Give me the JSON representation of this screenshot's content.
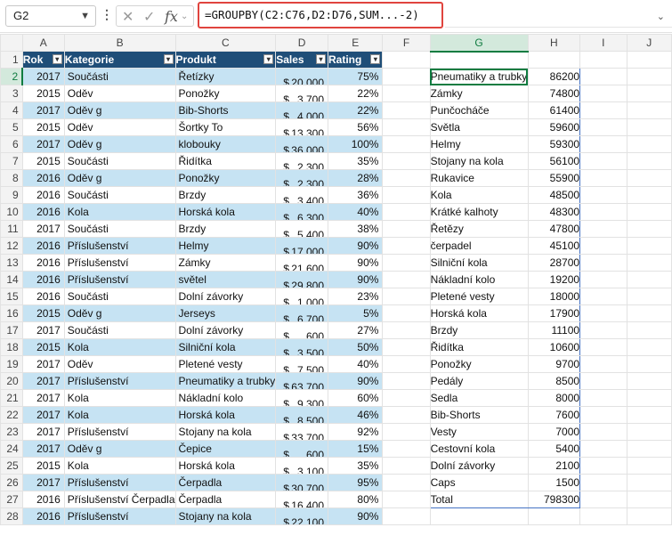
{
  "formula_bar": {
    "name_box": "G2",
    "formula": "=GROUPBY(C2:C76,D2:D76,SUM...-2)",
    "cancel_icon": "✕",
    "enter_icon": "✓",
    "fx_label": "fx"
  },
  "columns": [
    "A",
    "B",
    "C",
    "D",
    "E",
    "F",
    "G",
    "H",
    "I",
    "J"
  ],
  "headers": {
    "rok": "Rok",
    "kategorie": "Kategorie",
    "produkt": "Produkt",
    "sales": "Sales",
    "rating": "Rating"
  },
  "rows": [
    {
      "n": "2",
      "rok": "2017",
      "kat": "Součásti",
      "prod": "Řetízky",
      "cur": "$",
      "amt": "20,000",
      "rating": "75%",
      "g": "Pneumatiky a trubky",
      "h": "86200"
    },
    {
      "n": "3",
      "rok": "2015",
      "kat": "Oděv",
      "prod": "Ponožky",
      "cur": "$",
      "amt": "3,700",
      "rating": "22%",
      "g": "Zámky",
      "h": "74800"
    },
    {
      "n": "4",
      "rok": "2017",
      "kat": "Oděv g",
      "prod": "Bib-Shorts",
      "cur": "$",
      "amt": "4,000",
      "rating": "22%",
      "g": "Punčocháče",
      "h": "61400"
    },
    {
      "n": "5",
      "rok": "2015",
      "kat": "Oděv",
      "prod": "Šortky To",
      "cur": "$",
      "amt": "13,300",
      "rating": "56%",
      "g": "Světla",
      "h": "59600"
    },
    {
      "n": "6",
      "rok": "2017",
      "kat": "Oděv g",
      "prod": "klobouky",
      "cur": "$",
      "amt": "36,000",
      "rating": "100%",
      "g": "Helmy",
      "h": "59300"
    },
    {
      "n": "7",
      "rok": "2015",
      "kat": "Součásti",
      "prod": "Řidítka",
      "cur": "$",
      "amt": "2,300",
      "rating": "35%",
      "g": "Stojany na kola",
      "h": "56100"
    },
    {
      "n": "8",
      "rok": "2016",
      "kat": "Oděv g",
      "prod": "Ponožky",
      "cur": "$",
      "amt": "2,300",
      "rating": "28%",
      "g": "Rukavice",
      "h": "55900"
    },
    {
      "n": "9",
      "rok": "2016",
      "kat": "Součásti",
      "prod": "Brzdy",
      "cur": "$",
      "amt": "3,400",
      "rating": "36%",
      "g": "Kola",
      "h": "48500"
    },
    {
      "n": "10",
      "rok": "2016",
      "kat": "Kola",
      "prod": "Horská kola",
      "cur": "$",
      "amt": "6,300",
      "rating": "40%",
      "g": "Krátké kalhoty",
      "h": "48300"
    },
    {
      "n": "11",
      "rok": "2017",
      "kat": "Součásti",
      "prod": "Brzdy",
      "cur": "$",
      "amt": "5,400",
      "rating": "38%",
      "g": "Řetězy",
      "h": "47800"
    },
    {
      "n": "12",
      "rok": "2016",
      "kat": "Příslušenství",
      "prod": "Helmy",
      "cur": "$",
      "amt": "17,000",
      "rating": "90%",
      "g": "čerpadel",
      "h": "45100"
    },
    {
      "n": "13",
      "rok": "2016",
      "kat": "Příslušenství",
      "prod": "Zámky",
      "cur": "$",
      "amt": "21,600",
      "rating": "90%",
      "g": "Silniční kola",
      "h": "28700"
    },
    {
      "n": "14",
      "rok": "2016",
      "kat": "Příslušenství",
      "prod": "světel",
      "cur": "$",
      "amt": "29,800",
      "rating": "90%",
      "g": "Nákladní kolo",
      "h": "19200"
    },
    {
      "n": "15",
      "rok": "2016",
      "kat": "Součásti",
      "prod": "Dolní závorky",
      "cur": "$",
      "amt": "1,000",
      "rating": "23%",
      "g": "Pletené vesty",
      "h": "18000"
    },
    {
      "n": "16",
      "rok": "2015",
      "kat": "Oděv g",
      "prod": "Jerseys",
      "cur": "$",
      "amt": "6,700",
      "rating": "5%",
      "g": "Horská kola",
      "h": "17900"
    },
    {
      "n": "17",
      "rok": "2017",
      "kat": "Součásti",
      "prod": "Dolní závorky",
      "cur": "$",
      "amt": "600",
      "rating": "27%",
      "g": "Brzdy",
      "h": "11100"
    },
    {
      "n": "18",
      "rok": "2015",
      "kat": "Kola",
      "prod": "Silniční kola",
      "cur": "$",
      "amt": "3,500",
      "rating": "50%",
      "g": "Řidítka",
      "h": "10600"
    },
    {
      "n": "19",
      "rok": "2017",
      "kat": "Oděv",
      "prod": "Pletené vesty",
      "cur": "$",
      "amt": "7,500",
      "rating": "40%",
      "g": "Ponožky",
      "h": "9700"
    },
    {
      "n": "20",
      "rok": "2017",
      "kat": "Příslušenství",
      "prod": "Pneumatiky a trubky",
      "cur": "$",
      "amt": "63,700",
      "rating": "90%",
      "g": "Pedály",
      "h": "8500"
    },
    {
      "n": "21",
      "rok": "2017",
      "kat": "Kola",
      "prod": "Nákladní kolo",
      "cur": "$",
      "amt": "9,300",
      "rating": "60%",
      "g": "Sedla",
      "h": "8000"
    },
    {
      "n": "22",
      "rok": "2017",
      "kat": "Kola",
      "prod": "Horská kola",
      "cur": "$",
      "amt": "8,500",
      "rating": "46%",
      "g": "Bib-Shorts",
      "h": "7600"
    },
    {
      "n": "23",
      "rok": "2017",
      "kat": "Příslušenství",
      "prod": "Stojany na kola",
      "cur": "$",
      "amt": "33,700",
      "rating": "92%",
      "g": "Vesty",
      "h": "7000"
    },
    {
      "n": "24",
      "rok": "2017",
      "kat": "Oděv g",
      "prod": "Čepice",
      "cur": "$",
      "amt": "600",
      "rating": "15%",
      "g": "Cestovní kola",
      "h": "5400"
    },
    {
      "n": "25",
      "rok": "2015",
      "kat": "Kola",
      "prod": "Horská kola",
      "cur": "$",
      "amt": "3,100",
      "rating": "35%",
      "g": "Dolní závorky",
      "h": "2100"
    },
    {
      "n": "26",
      "rok": "2017",
      "kat": "Příslušenství",
      "prod": "Čerpadla",
      "cur": "$",
      "amt": "30,700",
      "rating": "95%",
      "g": "Caps",
      "h": "1500"
    },
    {
      "n": "27",
      "rok": "2016",
      "kat": "Příslušenství Čerpadla",
      "prod": "Čerpadla",
      "cur": "$",
      "amt": "16,400",
      "rating": "80%",
      "g": "Total",
      "h": "798300"
    },
    {
      "n": "28",
      "rok": "2016",
      "kat": "Příslušenství",
      "prod": "Stojany na kola",
      "cur": "$",
      "amt": "22,100",
      "rating": "90%",
      "g": "",
      "h": ""
    }
  ]
}
